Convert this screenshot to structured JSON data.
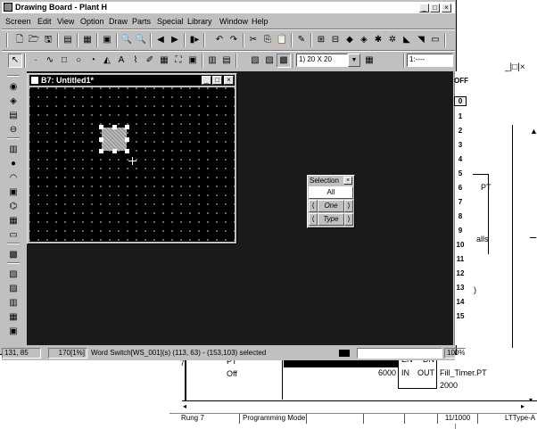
{
  "app": {
    "title": "Drawing Board - Plant H",
    "menu": [
      "Screen",
      "Edit",
      "View",
      "Option",
      "Draw",
      "Parts",
      "Special",
      "Library",
      "Window",
      "Help"
    ]
  },
  "toolbar1": {
    "icons": [
      "new-icon",
      "open-icon",
      "save-icon",
      "cut-icon",
      "copy-icon",
      "paste-icon",
      "zoom-in-icon",
      "zoom-out-icon",
      "prev-icon",
      "next-icon",
      "jump-icon",
      "undo-icon",
      "redo-icon",
      "scissors-icon",
      "copy2-icon",
      "paste2-icon",
      "pen-icon",
      "group-icon",
      "ungroup-icon",
      "align-icon",
      "flip-icon",
      "rotate-icon",
      "front-icon",
      "back-icon",
      "grid-icon"
    ]
  },
  "toolbar2": {
    "grid_select": "1) 20 X 20",
    "layer_select": "1:----"
  },
  "child_window": {
    "title": "B7: Untitled1*"
  },
  "selection_palette": {
    "title": "Selection",
    "all": "All",
    "one": "One",
    "type": "Type"
  },
  "layer_numbers": [
    "OFF",
    "0",
    "1",
    "2",
    "3",
    "4",
    "5",
    "6",
    "7",
    "8",
    "9",
    "10",
    "11",
    "12",
    "13",
    "14",
    "15"
  ],
  "status": {
    "coords": "131, 85",
    "zoom": "170[1%]",
    "message": "Word Switch[WS_001](s) (113, 63) - (153,103) selected",
    "percent": "100%"
  },
  "background_app": {
    "win_controls": "_|□|×",
    "pt_label": "PT",
    "calls_label": "alls",
    "bracket": ")",
    "ladder": {
      "value_7": "7",
      "pt_top": "PT",
      "off": "Off",
      "en": "EN",
      "dn": "DN",
      "in": "IN",
      "out": "OUT",
      "value_6000": "6000",
      "fill_timer": "Fill_Timer.PT",
      "value_2000": "2000"
    },
    "status": {
      "rung": "Rung 7",
      "mode": "Programming Mode",
      "counter": "11/1000",
      "type": "LTType-A"
    }
  }
}
